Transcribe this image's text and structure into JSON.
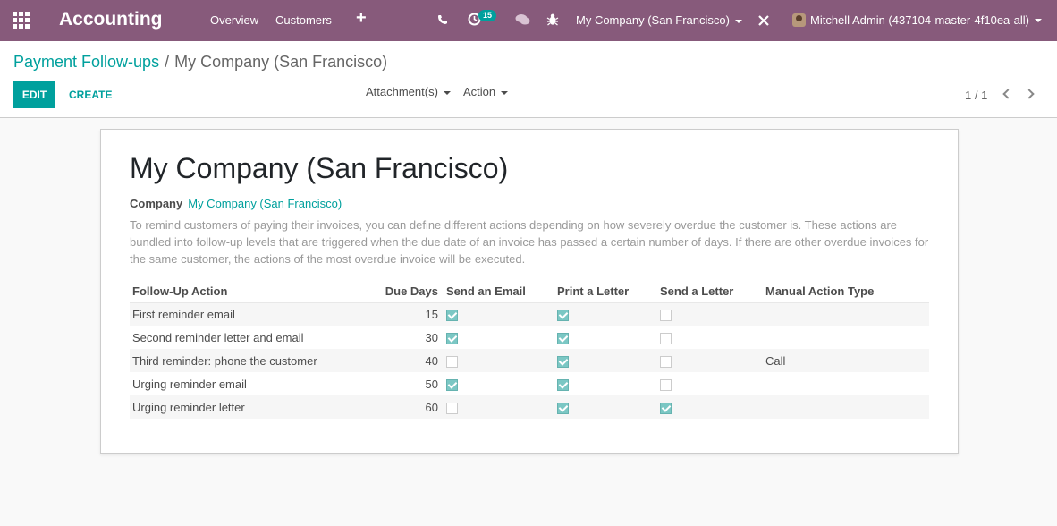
{
  "navbar": {
    "app_title": "Accounting",
    "menu_overview": "Overview",
    "menu_customers": "Customers",
    "menu_new": "+",
    "activity_count": "15",
    "company": "My Company (San Francisco)",
    "user": "Mitchell Admin (437104-master-4f10ea-all)"
  },
  "control_panel": {
    "breadcrumb_parent": "Payment Follow-ups",
    "breadcrumb_separator": "/",
    "breadcrumb_current": "My Company (San Francisco)",
    "edit_label": "EDIT",
    "create_label": "CREATE",
    "attachments_label": "Attachment(s)",
    "action_label": "Action",
    "pager": "1 / 1"
  },
  "form": {
    "title": "My Company (San Francisco)",
    "company_label": "Company",
    "company_value": "My Company (San Francisco)",
    "help_text": "To remind customers of paying their invoices, you can define different actions depending on how severely overdue the customer is. These actions are bundled into follow-up levels that are triggered when the due date of an invoice has passed a certain number of days. If there are other overdue invoices for the same customer, the actions of the most overdue invoice will be executed."
  },
  "table": {
    "headers": [
      "Follow-Up Action",
      "Due Days",
      "Send an Email",
      "Print a Letter",
      "Send a Letter",
      "Manual Action Type"
    ],
    "rows": [
      {
        "action": "First reminder email",
        "due_days": "15",
        "send_email": true,
        "print_letter": true,
        "send_letter": false,
        "manual_action": ""
      },
      {
        "action": "Second reminder letter and email",
        "due_days": "30",
        "send_email": true,
        "print_letter": true,
        "send_letter": false,
        "manual_action": ""
      },
      {
        "action": "Third reminder: phone the customer",
        "due_days": "40",
        "send_email": false,
        "print_letter": true,
        "send_letter": false,
        "manual_action": "Call"
      },
      {
        "action": "Urging reminder email",
        "due_days": "50",
        "send_email": true,
        "print_letter": true,
        "send_letter": false,
        "manual_action": ""
      },
      {
        "action": "Urging reminder letter",
        "due_days": "60",
        "send_email": false,
        "print_letter": true,
        "send_letter": true,
        "manual_action": ""
      }
    ]
  },
  "colors": {
    "navbar": "#875a7b",
    "accent": "#00a09d",
    "checkbox_on": "#7bc7c4"
  }
}
